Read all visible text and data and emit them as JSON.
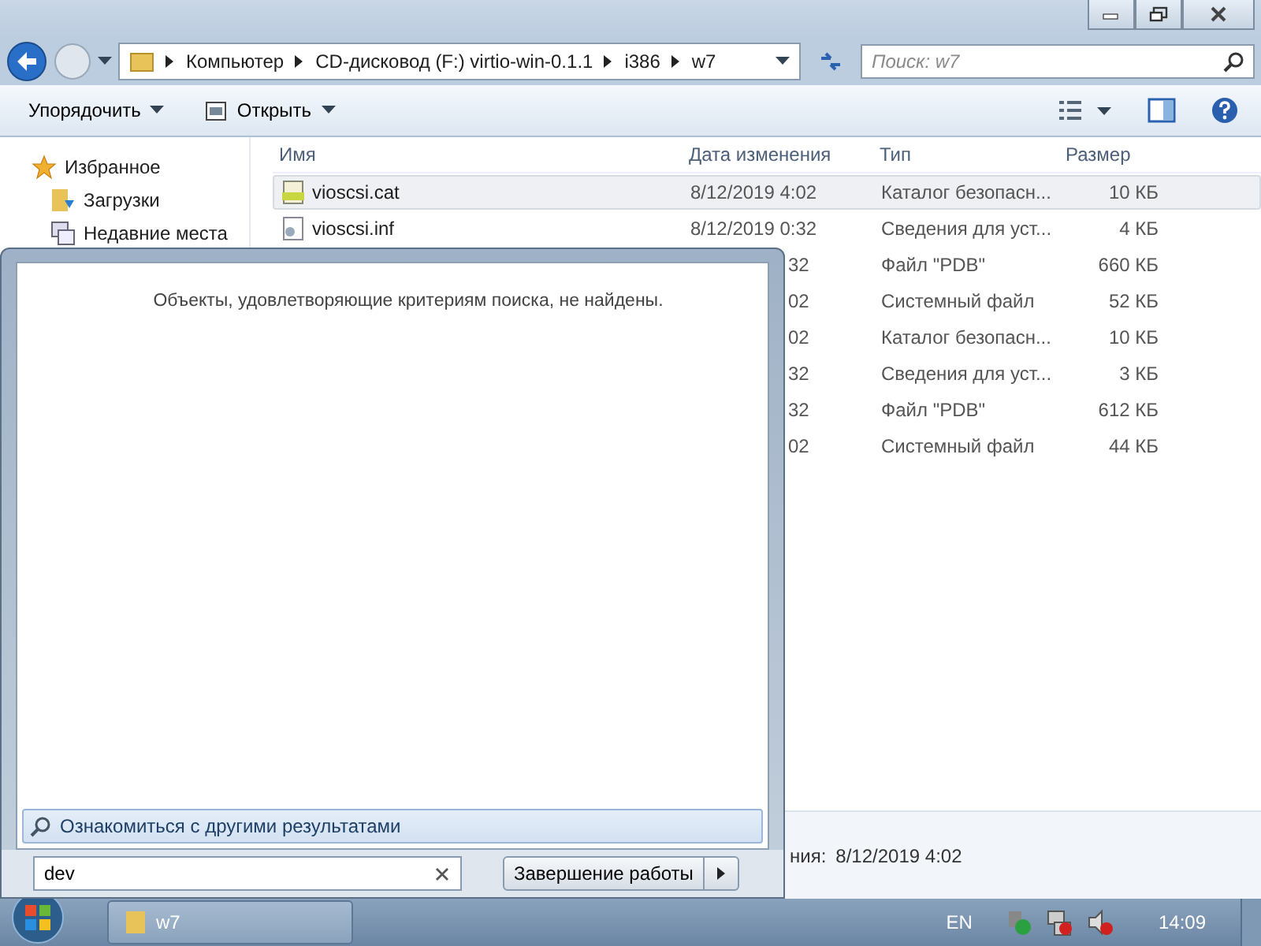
{
  "address": {
    "crumbs": [
      "Компьютер",
      "CD-дисковод (F:) virtio-win-0.1.1",
      "i386",
      "w7"
    ],
    "search_placeholder": "Поиск: w7"
  },
  "toolbar": [
    "Упорядочить",
    "Открыть"
  ],
  "sidebar": {
    "items": [
      {
        "label": "Избранное",
        "children": [
          {
            "label": "Загрузки"
          },
          {
            "label": "Недавние места"
          }
        ]
      }
    ]
  },
  "table": {
    "columns": [
      "Имя",
      "Дата изменения",
      "Тип",
      "Размер"
    ],
    "rows": [
      {
        "kind": "full",
        "name": "vioscsi.cat",
        "date": "8/12/2019 4:02",
        "type": "Каталог безопасн...",
        "size": "10 КБ",
        "selected": true
      },
      {
        "kind": "full",
        "name": "vioscsi.inf",
        "date": "8/12/2019 0:32",
        "type": "Сведения для уст...",
        "size": "4 КБ",
        "selected": false
      },
      {
        "kind": "covered",
        "date": "32",
        "type": "Файл \"PDB\"",
        "size": "660 КБ",
        "selected": false
      },
      {
        "kind": "covered",
        "date": "02",
        "type": "Системный файл",
        "size": "52 КБ",
        "selected": false
      },
      {
        "kind": "covered",
        "date": "02",
        "type": "Каталог безопасн...",
        "size": "10 КБ",
        "selected": false
      },
      {
        "kind": "covered",
        "date": "32",
        "type": "Сведения для уст...",
        "size": "3 КБ",
        "selected": false
      },
      {
        "kind": "covered",
        "date": "32",
        "type": "Файл \"PDB\"",
        "size": "612 КБ",
        "selected": false
      },
      {
        "kind": "covered",
        "date": "02",
        "type": "Системный файл",
        "size": "44 КБ",
        "selected": false
      }
    ]
  },
  "status_bar": {
    "label": "ния:",
    "value": "8/12/2019 4:02"
  },
  "start_menu": {
    "message": "Объекты, удовлетворяющие критериям поиска, не найдены.",
    "more_results": "Ознакомиться с другими результатами",
    "search_value": "dev",
    "shutdown": "Завершение работы"
  },
  "taskbar": {
    "task": "w7",
    "language": "EN",
    "clock": "14:09"
  }
}
